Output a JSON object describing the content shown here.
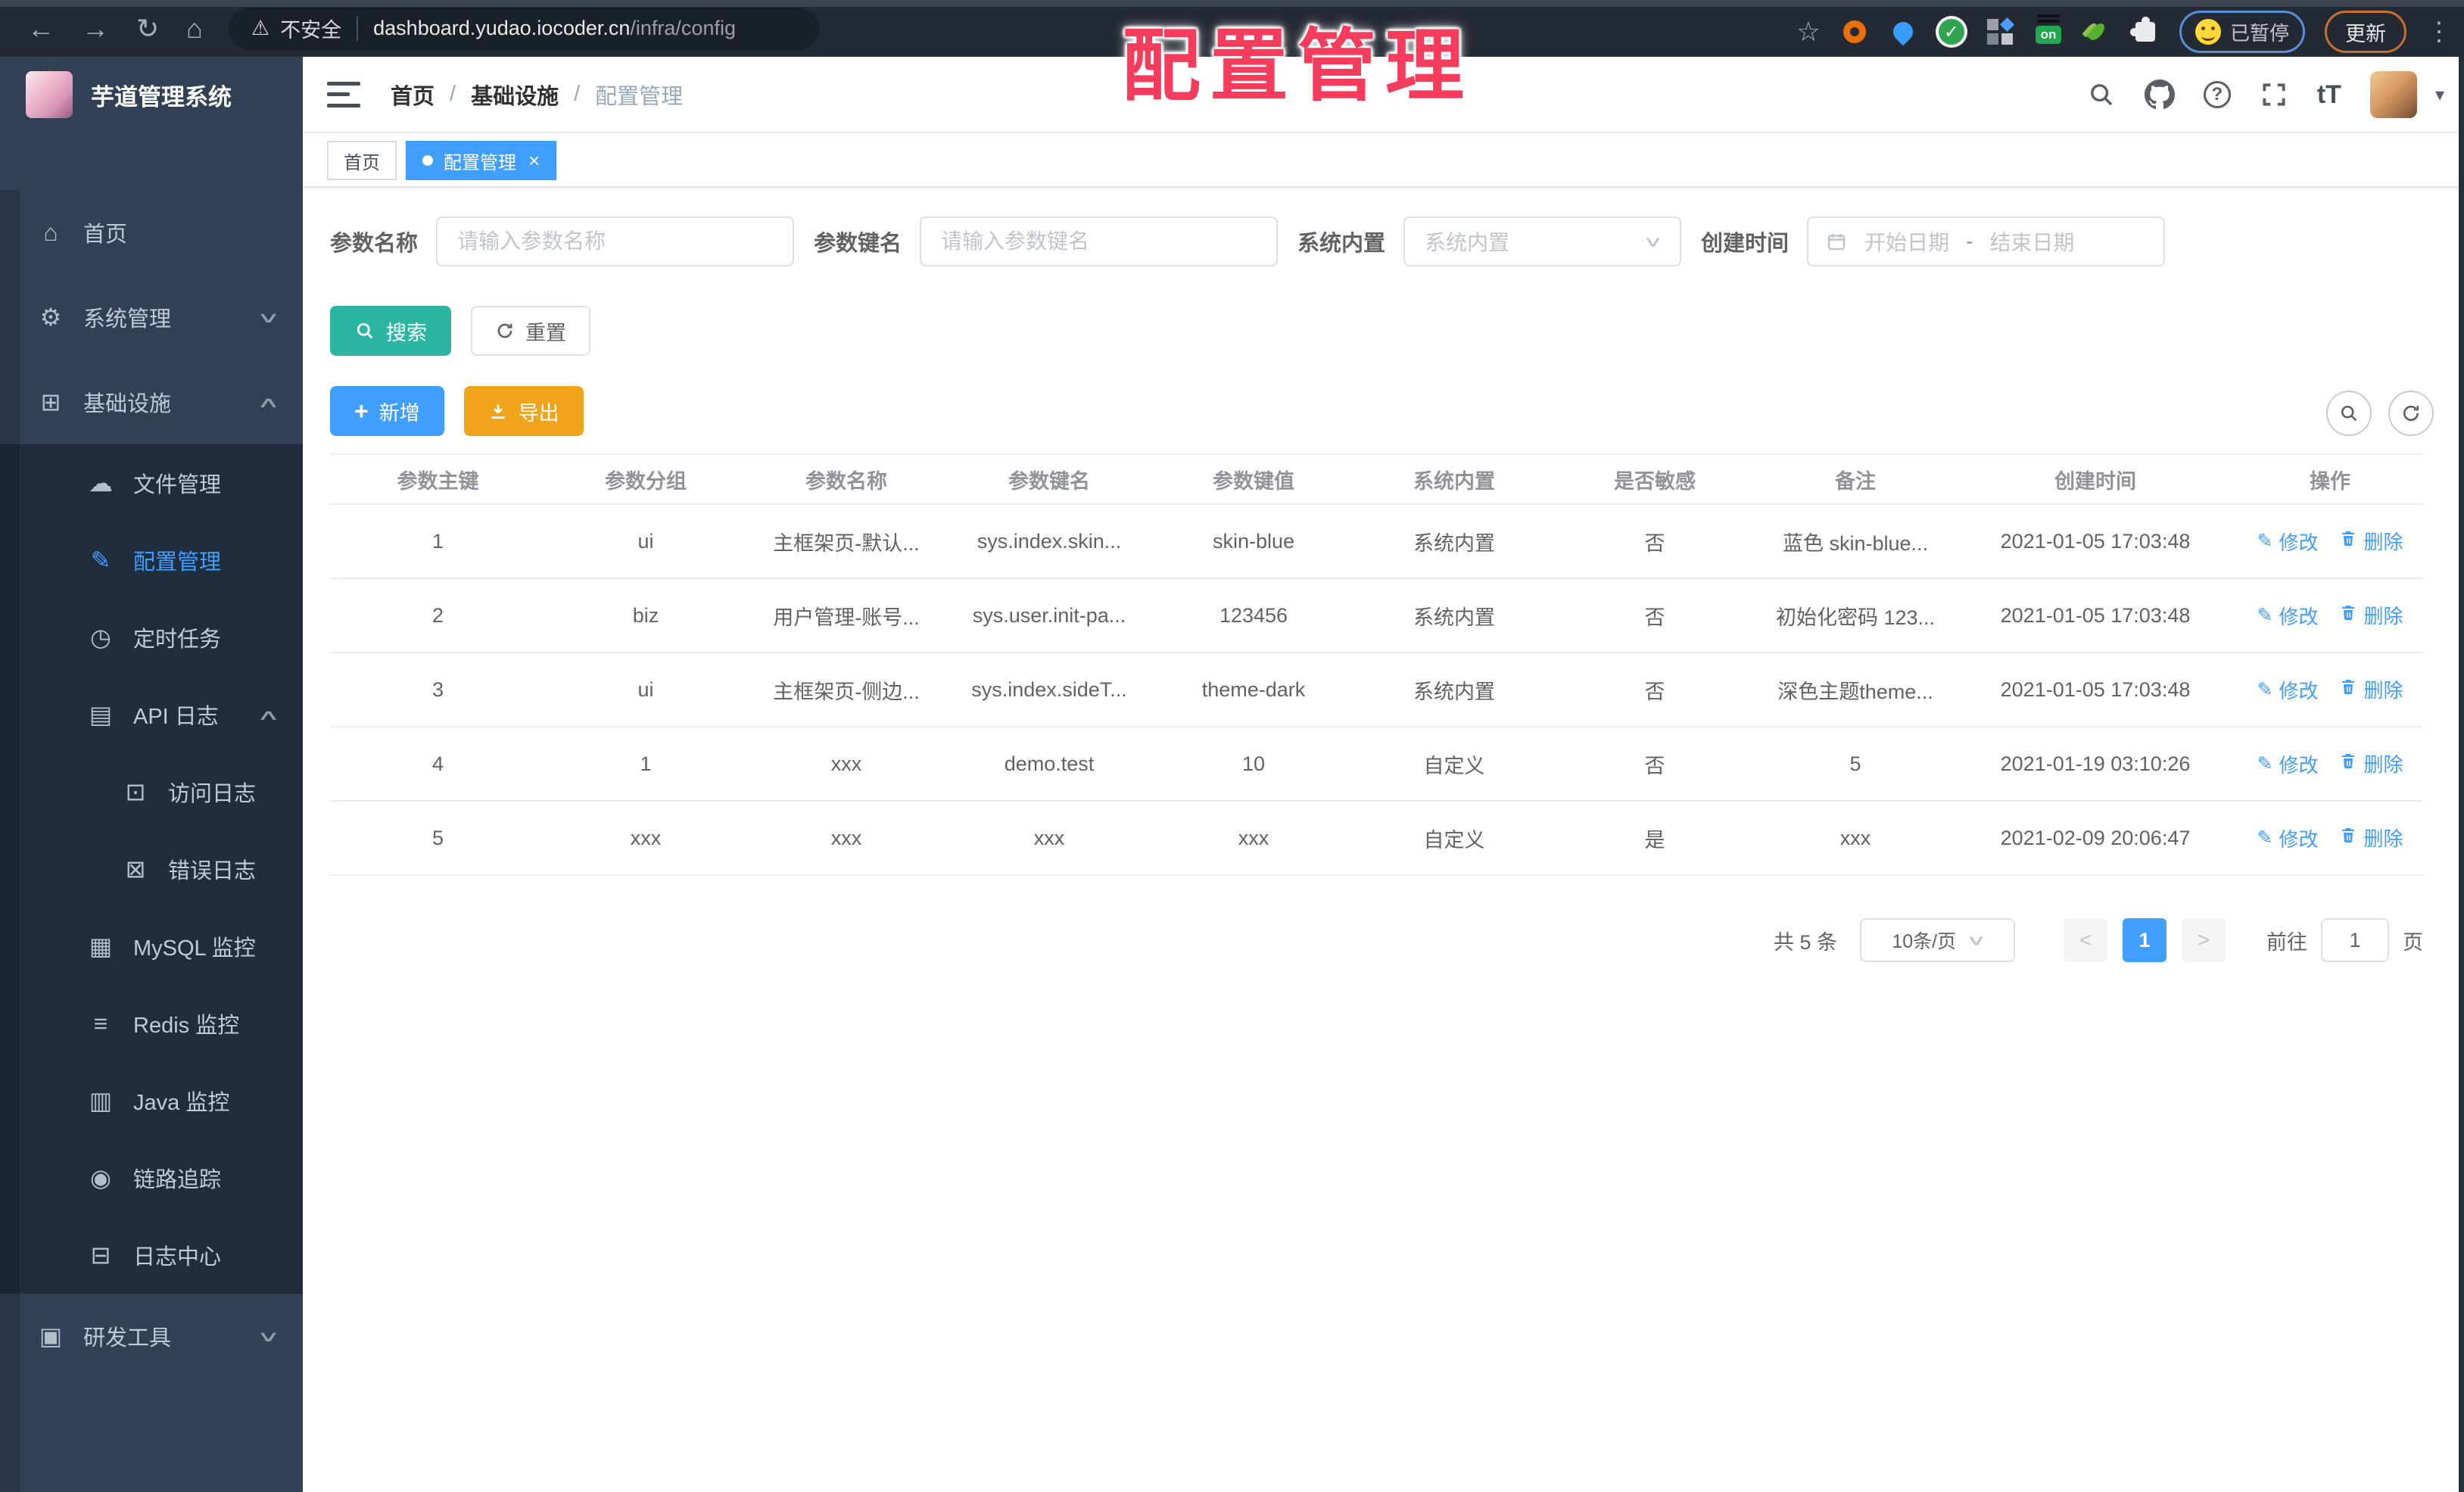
{
  "browser": {
    "security_label": "不安全",
    "host": "dashboard.yudao.iocoder.cn",
    "path": "/infra/config",
    "extension_on_label": "on",
    "paused_badge_label": "已暂停",
    "update_button_label": "更新"
  },
  "watermark_text": "配置管理",
  "sidebar": {
    "logo_title": "芋道管理系统",
    "items": [
      {
        "label": "首页",
        "icon": "home-icon",
        "level": 1
      },
      {
        "label": "系统管理",
        "icon": "gear-icon",
        "level": 1,
        "chevron": "down"
      },
      {
        "label": "基础设施",
        "icon": "infrastructure-icon",
        "level": 1,
        "chevron": "up"
      },
      {
        "label": "文件管理",
        "icon": "file-manage-icon",
        "level": 2
      },
      {
        "label": "配置管理",
        "icon": "config-icon",
        "level": 2,
        "active": true
      },
      {
        "label": "定时任务",
        "icon": "timer-icon",
        "level": 2
      },
      {
        "label": "API 日志",
        "icon": "api-log-icon",
        "level": 2,
        "chevron": "up"
      },
      {
        "label": "访问日志",
        "icon": "access-log-icon",
        "level": 3
      },
      {
        "label": "错误日志",
        "icon": "error-log-icon",
        "level": 3
      },
      {
        "label": "MySQL 监控",
        "icon": "mysql-icon",
        "level": 2
      },
      {
        "label": "Redis 监控",
        "icon": "redis-icon",
        "level": 2
      },
      {
        "label": "Java 监控",
        "icon": "java-icon",
        "level": 2
      },
      {
        "label": "链路追踪",
        "icon": "trace-icon",
        "level": 2
      },
      {
        "label": "日志中心",
        "icon": "log-center-icon",
        "level": 2
      },
      {
        "label": "研发工具",
        "icon": "devtools-icon",
        "level": 1,
        "chevron": "down"
      }
    ]
  },
  "app_header": {
    "breadcrumb": [
      "首页",
      "基础设施",
      "配置管理"
    ],
    "font_size_icon_text": "tT"
  },
  "tab_bar": {
    "tabs": [
      {
        "label": "首页",
        "active": false,
        "closable": false
      },
      {
        "label": "配置管理",
        "active": true,
        "closable": true
      }
    ]
  },
  "filters": {
    "param_name": {
      "label": "参数名称",
      "placeholder": "请输入参数名称",
      "value": ""
    },
    "param_key": {
      "label": "参数键名",
      "placeholder": "请输入参数键名",
      "value": ""
    },
    "system_builtin": {
      "label": "系统内置",
      "placeholder": "系统内置"
    },
    "create_time": {
      "label": "创建时间",
      "start_placeholder": "开始日期",
      "separator": "-",
      "end_placeholder": "结束日期"
    }
  },
  "actions": {
    "search": "搜索",
    "reset": "重置",
    "add": "新增",
    "export": "导出"
  },
  "table": {
    "headers": [
      "参数主键",
      "参数分组",
      "参数名称",
      "参数键名",
      "参数键值",
      "系统内置",
      "是否敏感",
      "备注",
      "创建时间",
      "操作"
    ],
    "action_labels": {
      "edit": "修改",
      "delete": "删除"
    },
    "rows": [
      [
        "1",
        "ui",
        "主框架页-默认...",
        "sys.index.skin...",
        "skin-blue",
        "系统内置",
        "否",
        "蓝色 skin-blue...",
        "2021-01-05 17:03:48"
      ],
      [
        "2",
        "biz",
        "用户管理-账号...",
        "sys.user.init-pa...",
        "123456",
        "系统内置",
        "否",
        "初始化密码 123...",
        "2021-01-05 17:03:48"
      ],
      [
        "3",
        "ui",
        "主框架页-侧边...",
        "sys.index.sideT...",
        "theme-dark",
        "系统内置",
        "否",
        "深色主题theme...",
        "2021-01-05 17:03:48"
      ],
      [
        "4",
        "1",
        "xxx",
        "demo.test",
        "10",
        "自定义",
        "否",
        "5",
        "2021-01-19 03:10:26"
      ],
      [
        "5",
        "xxx",
        "xxx",
        "xxx",
        "xxx",
        "自定义",
        "是",
        "xxx",
        "2021-02-09 20:06:47"
      ]
    ]
  },
  "pagination": {
    "total_text": "共 5 条",
    "page_size": "10条/页",
    "current_page": "1",
    "goto_label": "前往",
    "goto_value": "1",
    "page_unit": "页"
  },
  "colors": {
    "primary": "#409EFF",
    "search_teal": "#2BB5A3",
    "export_orange": "#F0A41C",
    "watermark_red": "#F53C5C",
    "sidebar_bg": "#304156",
    "submenu_bg": "#1F2D3D"
  }
}
